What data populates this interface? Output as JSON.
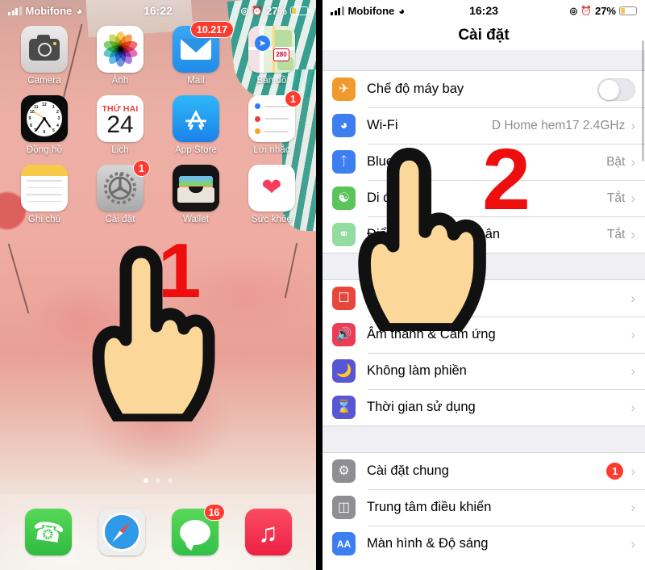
{
  "home": {
    "status": {
      "carrier": "Mobifone",
      "wifi_icon": "wifi-icon",
      "time": "16:22",
      "battery_percent": "27%",
      "alarm_icon": "alarm-icon",
      "lock_rotation_icon": "rotation-lock-icon"
    },
    "apps": [
      {
        "label": "Camera",
        "icon": "camera-icon",
        "badge": null
      },
      {
        "label": "Ảnh",
        "icon": "photos-icon",
        "badge": null
      },
      {
        "label": "Mail",
        "icon": "mail-icon",
        "badge": "10.217"
      },
      {
        "label": "Bản đồ",
        "icon": "maps-icon",
        "badge": null
      },
      {
        "label": "Đồng hồ",
        "icon": "clock-icon",
        "badge": null
      },
      {
        "label": "Lịch",
        "icon": "calendar-icon",
        "badge": null,
        "cal_weekday": "THỨ HAI",
        "cal_day": "24"
      },
      {
        "label": "App Store",
        "icon": "appstore-icon",
        "badge": null
      },
      {
        "label": "Lời nhắc",
        "icon": "reminders-icon",
        "badge": "1"
      },
      {
        "label": "Ghi chú",
        "icon": "notes-icon",
        "badge": null
      },
      {
        "label": "Cài đặt",
        "icon": "settings-gear-icon",
        "badge": "1"
      },
      {
        "label": "Wallet",
        "icon": "wallet-icon",
        "badge": null
      },
      {
        "label": "Sức khỏe",
        "icon": "health-heart-icon",
        "badge": null
      }
    ],
    "dock": [
      {
        "label": "Phone",
        "icon": "phone-icon",
        "badge": null
      },
      {
        "label": "Safari",
        "icon": "safari-compass-icon",
        "badge": null
      },
      {
        "label": "Messages",
        "icon": "messages-bubble-icon",
        "badge": "16"
      },
      {
        "label": "Music",
        "icon": "music-note-icon",
        "badge": null
      }
    ],
    "page_dots": {
      "count": 3,
      "active": 1
    },
    "annotation": {
      "step": "1",
      "hand": "pointing-hand-cursor"
    }
  },
  "settings": {
    "status": {
      "carrier": "Mobifone",
      "wifi_icon": "wifi-icon",
      "time": "16:23",
      "battery_percent": "27%"
    },
    "title": "Cài đặt",
    "annotation": {
      "step": "2",
      "hand": "pointing-hand-cursor"
    },
    "group1": [
      {
        "label": "Chế độ máy bay",
        "icon": "airplane-icon",
        "icon_color": "#f09a2c",
        "control": "toggle",
        "value": ""
      },
      {
        "label": "Wi-Fi",
        "icon": "wifi-icon",
        "icon_color": "#3d7ef0",
        "control": "chevron",
        "value": "D Home hem17 2.4GHz"
      },
      {
        "label": "Bluetooth",
        "icon": "bluetooth-icon",
        "icon_color": "#3d7ef0",
        "control": "chevron",
        "value": "Bật"
      },
      {
        "label": "Di động",
        "icon": "cellular-antenna-icon",
        "icon_color": "#5bc45b",
        "control": "chevron",
        "value": "Tắt"
      },
      {
        "label": "Điểm truy cập cá nhân",
        "icon": "hotspot-icon",
        "icon_color": "#93dba0",
        "control": "chevron",
        "value": "Tắt"
      }
    ],
    "group2": [
      {
        "label": "Thông báo",
        "icon": "notifications-icon",
        "icon_color": "#e8453c",
        "control": "chevron",
        "value": ""
      },
      {
        "label": "Âm thanh & Cảm ứng",
        "icon": "sound-icon",
        "icon_color": "#ef3b55",
        "control": "chevron",
        "value": ""
      },
      {
        "label": "Không làm phiền",
        "icon": "moon-icon",
        "icon_color": "#5756d5",
        "control": "chevron",
        "value": ""
      },
      {
        "label": "Thời gian sử dụng",
        "icon": "hourglass-icon",
        "icon_color": "#5756d5",
        "control": "chevron",
        "value": ""
      }
    ],
    "group3": [
      {
        "label": "Cài đặt chung",
        "icon": "gear-icon",
        "icon_color": "#8e8e93",
        "control": "badge-chevron",
        "value": "",
        "badge": "1"
      },
      {
        "label": "Trung tâm điều khiển",
        "icon": "control-center-icon",
        "icon_color": "#8e8e93",
        "control": "chevron",
        "value": ""
      },
      {
        "label": "Màn hình & Độ sáng",
        "icon": "display-aa-icon",
        "icon_color": "#3d7ef0",
        "control": "chevron",
        "value": ""
      }
    ]
  }
}
